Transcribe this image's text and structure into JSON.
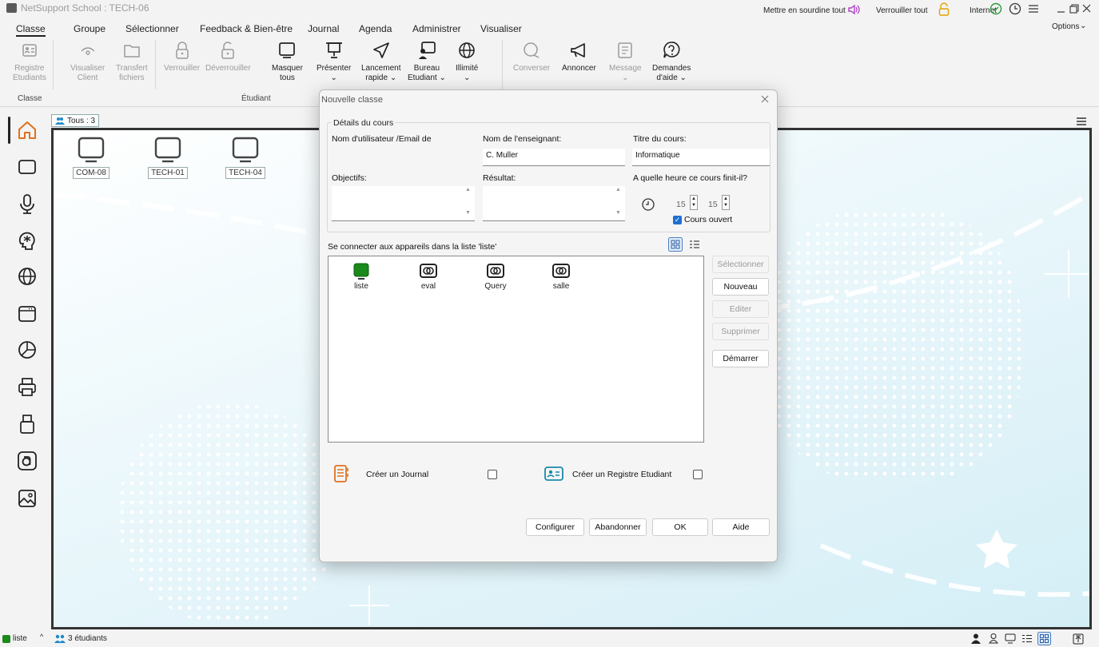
{
  "app": {
    "title": "NetSupport School : TECH-06"
  },
  "menu": {
    "items": [
      "Classe",
      "Groupe",
      "Sélectionner",
      "Feedback & Bien-être",
      "Journal",
      "Agenda",
      "Administrer",
      "Visualiser"
    ]
  },
  "top_right": {
    "mute_all": "Mettre en sourdine tout",
    "lock_all": "Verrouiller tout",
    "internet": "Internet",
    "options": "Options"
  },
  "ribbon": {
    "buttons": [
      {
        "label": "Registre\nEtudiants",
        "icon": "registry-icon"
      },
      {
        "label": "Visualiser\nClient",
        "icon": "eye-icon"
      },
      {
        "label": "Transfert\nfichiers",
        "icon": "folder-icon"
      },
      {
        "label": "Verrouiller",
        "icon": "lock-icon"
      },
      {
        "label": "Déverrouiller",
        "icon": "unlock-icon"
      },
      {
        "label": "Masquer\ntous",
        "icon": "monitor-icon"
      },
      {
        "label": "Présenter\n⌄",
        "icon": "present-icon"
      },
      {
        "label": "Lancement\nrapide ⌄",
        "icon": "send-icon"
      },
      {
        "label": "Bureau\nEtudiant ⌄",
        "icon": "student-desktop-icon"
      },
      {
        "label": "Illimité\n⌄",
        "icon": "globe-icon"
      },
      {
        "label": "Converser",
        "icon": "chat-icon"
      },
      {
        "label": "Annoncer",
        "icon": "megaphone-icon"
      },
      {
        "label": "Message\n⌄",
        "icon": "message-icon"
      },
      {
        "label": "Demandes\nd'aide ⌄",
        "icon": "help-icon"
      }
    ],
    "groups": [
      "Classe",
      "Étudiant"
    ]
  },
  "toolbar": {
    "group_tag": "Tous : 3"
  },
  "devices": [
    "COM-08",
    "TECH-01",
    "TECH-04"
  ],
  "dialog": {
    "title": "Nouvelle classe",
    "section_title": "Détails du cours",
    "user_label": "Nom d'utilisateur /Email de",
    "teacher_label": "Nom de l'enseignant:",
    "teacher_value": "C. Muller",
    "course_label": "Titre du cours:",
    "course_value": "Informatique",
    "objectives_label": "Objectifs:",
    "result_label": "Résultat:",
    "end_time_label": "A quelle heure ce cours finit-il?",
    "hour": "15",
    "minute": "15",
    "open_course": "Cours ouvert",
    "connect_label": "Se connecter aux appareils dans la liste 'liste'",
    "lists": [
      "liste",
      "eval",
      "Query",
      "salle"
    ],
    "side_buttons": [
      "Sélectionner",
      "Nouveau",
      "Editer",
      "Supprimer",
      "Démarrer"
    ],
    "create_journal": "Créer un Journal",
    "create_registry": "Créer un Registre Etudiant",
    "footer_buttons": [
      "Configurer",
      "Abandonner",
      "OK",
      "Aide"
    ]
  },
  "statusbar": {
    "list": "liste",
    "students": "3 étudiants"
  }
}
